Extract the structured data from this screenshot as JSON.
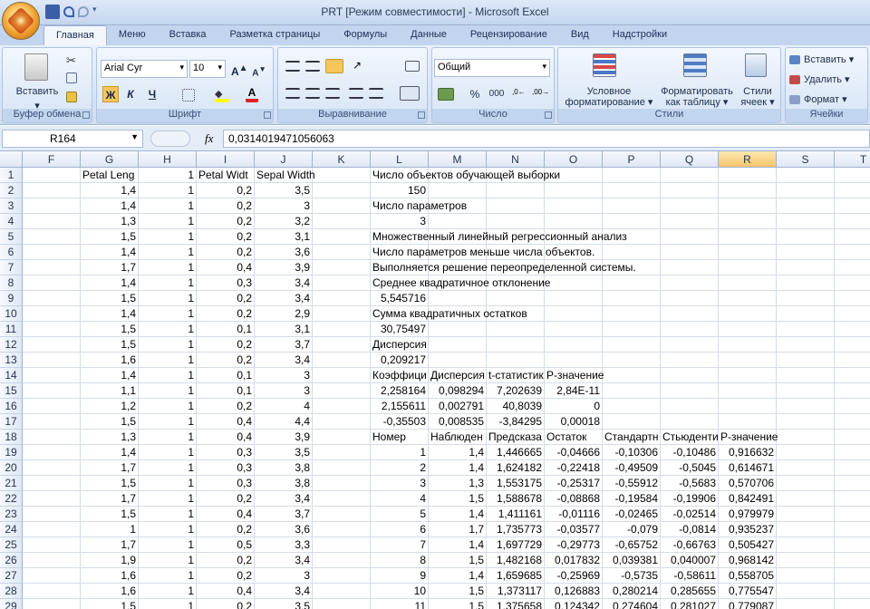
{
  "window": {
    "title": "PRT  [Режим совместимости] - Microsoft Excel"
  },
  "tabs": [
    "Главная",
    "Меню",
    "Вставка",
    "Разметка страницы",
    "Формулы",
    "Данные",
    "Рецензирование",
    "Вид",
    "Надстройки"
  ],
  "ribbon": {
    "clipboard": {
      "label": "Буфер обмена",
      "paste": "Вставить"
    },
    "font": {
      "label": "Шрифт",
      "font_name": "Arial Cyr",
      "font_size": "10",
      "bold": "Ж",
      "italic": "К",
      "underline": "Ч"
    },
    "alignment": {
      "label": "Выравнивание"
    },
    "number": {
      "label": "Число",
      "format": "Общий",
      "percent": "%",
      "thousands": "000"
    },
    "styles": {
      "label": "Стили",
      "cond1": "Условное",
      "cond2": "форматирование",
      "table1": "Форматировать",
      "table2": "как таблицу",
      "cell1": "Стили",
      "cell2": "ячеек"
    },
    "cells": {
      "label": "Ячейки",
      "insert": "Вставить",
      "delete": "Удалить",
      "format": "Формат"
    }
  },
  "formula_bar": {
    "name_box": "R164",
    "fx": "fx",
    "value": "0,0314019471056063"
  },
  "columns": [
    "F",
    "G",
    "H",
    "I",
    "J",
    "K",
    "L",
    "M",
    "N",
    "O",
    "P",
    "Q",
    "R",
    "S",
    "T"
  ],
  "selected_column": "R",
  "rows": [
    {
      "n": "1",
      "c": {
        "G": "Petal Leng",
        "H": "1",
        "I": "Petal Widt",
        "J": "Sepal Width",
        "L": "Число объектов обучающей выборки"
      }
    },
    {
      "n": "2",
      "c": {
        "G": "1,4",
        "H": "1",
        "I": "0,2",
        "J": "3,5",
        "L": "150"
      }
    },
    {
      "n": "3",
      "c": {
        "G": "1,4",
        "H": "1",
        "I": "0,2",
        "J": "3",
        "L": "Число параметров"
      }
    },
    {
      "n": "4",
      "c": {
        "G": "1,3",
        "H": "1",
        "I": "0,2",
        "J": "3,2",
        "L": "3"
      }
    },
    {
      "n": "5",
      "c": {
        "G": "1,5",
        "H": "1",
        "I": "0,2",
        "J": "3,1",
        "L": "Множественный линейный регрессионный анализ"
      }
    },
    {
      "n": "6",
      "c": {
        "G": "1,4",
        "H": "1",
        "I": "0,2",
        "J": "3,6",
        "L": "Число параметров меньше числа объектов."
      }
    },
    {
      "n": "7",
      "c": {
        "G": "1,7",
        "H": "1",
        "I": "0,4",
        "J": "3,9",
        "L": "Выполняется решение переопределенной системы."
      }
    },
    {
      "n": "8",
      "c": {
        "G": "1,4",
        "H": "1",
        "I": "0,3",
        "J": "3,4",
        "L": "Среднее квадратичное отклонение"
      }
    },
    {
      "n": "9",
      "c": {
        "G": "1,5",
        "H": "1",
        "I": "0,2",
        "J": "3,4",
        "L": "5,545716"
      }
    },
    {
      "n": "10",
      "c": {
        "G": "1,4",
        "H": "1",
        "I": "0,2",
        "J": "2,9",
        "L": "Сумма квадратичных остатков"
      }
    },
    {
      "n": "11",
      "c": {
        "G": "1,5",
        "H": "1",
        "I": "0,1",
        "J": "3,1",
        "L": "30,75497"
      }
    },
    {
      "n": "12",
      "c": {
        "G": "1,5",
        "H": "1",
        "I": "0,2",
        "J": "3,7",
        "L": "Дисперсия"
      }
    },
    {
      "n": "13",
      "c": {
        "G": "1,6",
        "H": "1",
        "I": "0,2",
        "J": "3,4",
        "L": "0,209217"
      }
    },
    {
      "n": "14",
      "c": {
        "G": "1,4",
        "H": "1",
        "I": "0,1",
        "J": "3",
        "L": "Коэффици",
        "M": "Дисперсия",
        "N": "t-статистик",
        "O": "P-значение"
      }
    },
    {
      "n": "15",
      "c": {
        "G": "1,1",
        "H": "1",
        "I": "0,1",
        "J": "3",
        "L": "2,258164",
        "M": "0,098294",
        "N": "7,202639",
        "O": "2,84E-11"
      }
    },
    {
      "n": "16",
      "c": {
        "G": "1,2",
        "H": "1",
        "I": "0,2",
        "J": "4",
        "L": "2,155611",
        "M": "0,002791",
        "N": "40,8039",
        "O": "0"
      }
    },
    {
      "n": "17",
      "c": {
        "G": "1,5",
        "H": "1",
        "I": "0,4",
        "J": "4,4",
        "L": "-0,35503",
        "M": "0,008535",
        "N": "-3,84295",
        "O": "0,00018"
      }
    },
    {
      "n": "18",
      "c": {
        "G": "1,3",
        "H": "1",
        "I": "0,4",
        "J": "3,9",
        "L": "Номер",
        "M": "Наблюден",
        "N": "Предсказа",
        "O": "Остаток",
        "P": "Стандартн",
        "Q": "Стьюденти",
        "R": "P-значение"
      }
    },
    {
      "n": "19",
      "c": {
        "G": "1,4",
        "H": "1",
        "I": "0,3",
        "J": "3,5",
        "L": "1",
        "M": "1,4",
        "N": "1,446665",
        "O": "-0,04666",
        "P": "-0,10306",
        "Q": "-0,10486",
        "R": "0,916632"
      }
    },
    {
      "n": "20",
      "c": {
        "G": "1,7",
        "H": "1",
        "I": "0,3",
        "J": "3,8",
        "L": "2",
        "M": "1,4",
        "N": "1,624182",
        "O": "-0,22418",
        "P": "-0,49509",
        "Q": "-0,5045",
        "R": "0,614671"
      }
    },
    {
      "n": "21",
      "c": {
        "G": "1,5",
        "H": "1",
        "I": "0,3",
        "J": "3,8",
        "L": "3",
        "M": "1,3",
        "N": "1,553175",
        "O": "-0,25317",
        "P": "-0,55912",
        "Q": "-0,5683",
        "R": "0,570706"
      }
    },
    {
      "n": "22",
      "c": {
        "G": "1,7",
        "H": "1",
        "I": "0,2",
        "J": "3,4",
        "L": "4",
        "M": "1,5",
        "N": "1,588678",
        "O": "-0,08868",
        "P": "-0,19584",
        "Q": "-0,19906",
        "R": "0,842491"
      }
    },
    {
      "n": "23",
      "c": {
        "G": "1,5",
        "H": "1",
        "I": "0,4",
        "J": "3,7",
        "L": "5",
        "M": "1,4",
        "N": "1,411161",
        "O": "-0,01116",
        "P": "-0,02465",
        "Q": "-0,02514",
        "R": "0,979979"
      }
    },
    {
      "n": "24",
      "c": {
        "G": "1",
        "H": "1",
        "I": "0,2",
        "J": "3,6",
        "L": "6",
        "M": "1,7",
        "N": "1,735773",
        "O": "-0,03577",
        "P": "-0,079",
        "Q": "-0,0814",
        "R": "0,935237"
      }
    },
    {
      "n": "25",
      "c": {
        "G": "1,7",
        "H": "1",
        "I": "0,5",
        "J": "3,3",
        "L": "7",
        "M": "1,4",
        "N": "1,697729",
        "O": "-0,29773",
        "P": "-0,65752",
        "Q": "-0,66763",
        "R": "0,505427"
      }
    },
    {
      "n": "26",
      "c": {
        "G": "1,9",
        "H": "1",
        "I": "0,2",
        "J": "3,4",
        "L": "8",
        "M": "1,5",
        "N": "1,482168",
        "O": "0,017832",
        "P": "0,039381",
        "Q": "0,040007",
        "R": "0,968142"
      }
    },
    {
      "n": "27",
      "c": {
        "G": "1,6",
        "H": "1",
        "I": "0,2",
        "J": "3",
        "L": "9",
        "M": "1,4",
        "N": "1,659685",
        "O": "-0,25969",
        "P": "-0,5735",
        "Q": "-0,58611",
        "R": "0,558705"
      }
    },
    {
      "n": "28",
      "c": {
        "G": "1,6",
        "H": "1",
        "I": "0,4",
        "J": "3,4",
        "L": "10",
        "M": "1,5",
        "N": "1,373117",
        "O": "0,126883",
        "P": "0,280214",
        "Q": "0,285655",
        "R": "0,775547"
      }
    },
    {
      "n": "29",
      "c": {
        "G": "1,5",
        "H": "1",
        "I": "0,2",
        "J": "3,5",
        "L": "11",
        "M": "1,5",
        "N": "1,375658",
        "O": "0,124342",
        "P": "0,274604",
        "Q": "0,281027",
        "R": "0,779087"
      }
    }
  ]
}
